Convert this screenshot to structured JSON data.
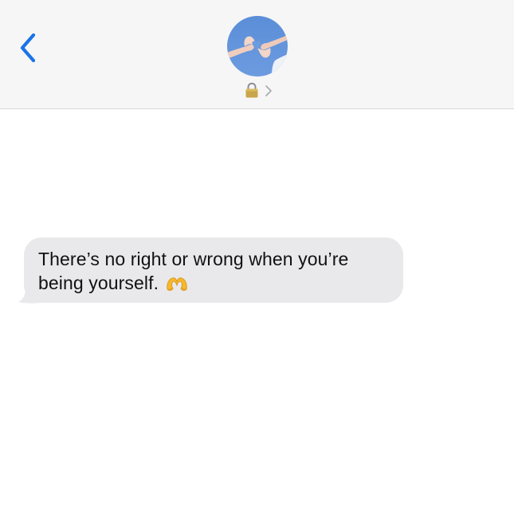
{
  "header": {
    "back_icon": "chevron-left-icon",
    "avatar_icon": "contact-photo-heart-hands",
    "lock_icon": "lock-icon",
    "details_chevron_icon": "chevron-right-icon",
    "accent_color": "#1a73e8",
    "background_color": "#f6f6f6"
  },
  "messages": [
    {
      "direction": "incoming",
      "text": "There’s no right or wrong when you’re being yourself.",
      "emoji": "heart-hands-emoji",
      "bubble_color": "#e9e9eb"
    }
  ]
}
